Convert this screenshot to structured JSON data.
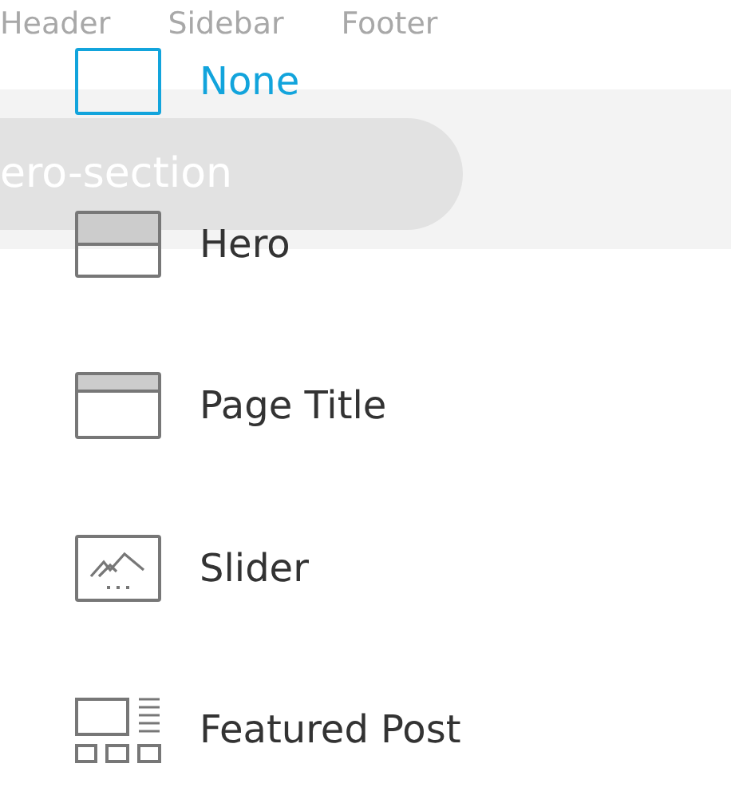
{
  "background": {
    "tabs": [
      {
        "label": "Header"
      },
      {
        "label": "Sidebar"
      },
      {
        "label": "Footer"
      }
    ],
    "section_field": {
      "value": "ero-section"
    }
  },
  "menu": {
    "items": [
      {
        "label": "None",
        "kind": "none",
        "selected": true
      },
      {
        "label": "Hero",
        "kind": "hero",
        "selected": false
      },
      {
        "label": "Page Title",
        "kind": "page-title",
        "selected": false
      },
      {
        "label": "Slider",
        "kind": "slider",
        "selected": false
      },
      {
        "label": "Featured Post",
        "kind": "featured-post",
        "selected": false
      }
    ]
  }
}
